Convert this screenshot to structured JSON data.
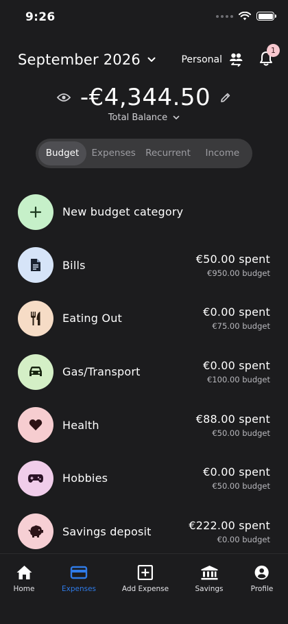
{
  "status_bar": {
    "time": "9:26"
  },
  "header": {
    "month": "September 2026",
    "account": "Personal",
    "notification_count": "1"
  },
  "balance": {
    "amount": "-€4,344.50",
    "caption": "Total Balance"
  },
  "tabs": [
    {
      "label": "Budget",
      "active": true
    },
    {
      "label": "Expenses",
      "active": false
    },
    {
      "label": "Recurrent",
      "active": false
    },
    {
      "label": "Income",
      "active": false
    }
  ],
  "new_category": {
    "label": "New budget category",
    "icon": "plus-icon",
    "color": "#c6f0c9"
  },
  "categories": [
    {
      "name": "Bills",
      "spent": "€50.00 spent",
      "budget": "€950.00 budget",
      "icon": "document-icon",
      "color": "#d6e4f8"
    },
    {
      "name": "Eating Out",
      "spent": "€0.00 spent",
      "budget": "€75.00 budget",
      "icon": "cutlery-icon",
      "color": "#f6dcc6"
    },
    {
      "name": "Gas/Transport",
      "spent": "€0.00 spent",
      "budget": "€100.00 budget",
      "icon": "car-icon",
      "color": "#d4efc6"
    },
    {
      "name": "Health",
      "spent": "€88.00 spent",
      "budget": "€50.00 budget",
      "icon": "heart-icon",
      "color": "#f6cdd0"
    },
    {
      "name": "Hobbies",
      "spent": "€0.00 spent",
      "budget": "€50.00 budget",
      "icon": "gamepad-icon",
      "color": "#f0cdea"
    },
    {
      "name": "Savings deposit",
      "spent": "€222.00 spent",
      "budget": "€0.00 budget",
      "icon": "piggy-bank-icon",
      "color": "#f6cfd4"
    }
  ],
  "nav": [
    {
      "label": "Home",
      "icon": "home-icon",
      "active": false
    },
    {
      "label": "Expenses",
      "icon": "credit-card-icon",
      "active": true
    },
    {
      "label": "Add Expense",
      "icon": "add-box-icon",
      "active": false
    },
    {
      "label": "Savings",
      "icon": "bank-icon",
      "active": false
    },
    {
      "label": "Profile",
      "icon": "profile-icon",
      "active": false
    }
  ],
  "colors": {
    "background": "#1c1c1e",
    "accent": "#2f7be8",
    "tab_track": "#3a3a3c"
  }
}
